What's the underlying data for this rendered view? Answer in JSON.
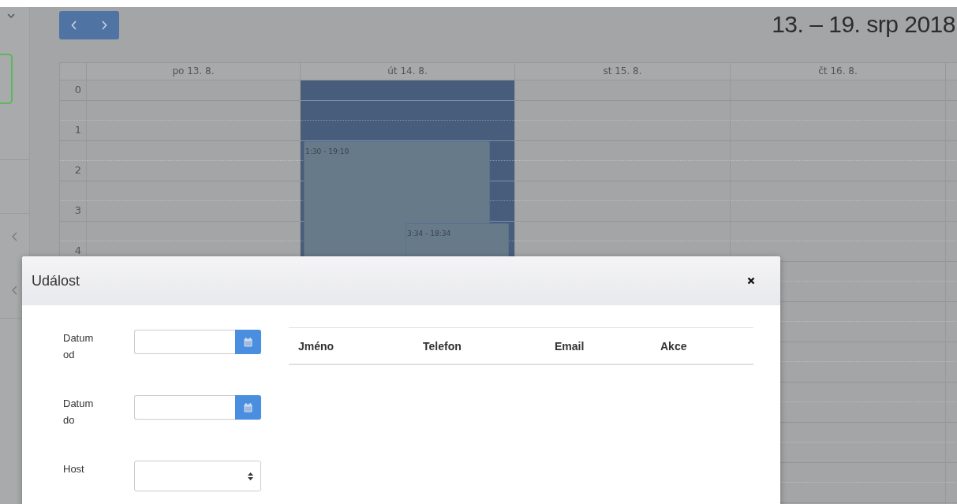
{
  "calendar": {
    "title": "13. – 19. srp 2018",
    "days": [
      {
        "label": "po 13. 8.",
        "selected": false
      },
      {
        "label": "út 14. 8.",
        "selected": true
      },
      {
        "label": "st 15. 8.",
        "selected": false
      },
      {
        "label": "čt 16. 8.",
        "selected": false
      }
    ],
    "hours": [
      "0",
      "1",
      "2",
      "3",
      "4"
    ],
    "events": [
      {
        "label": "1:30 - 19:10"
      },
      {
        "label": "3:34 - 18:34"
      }
    ]
  },
  "dialog": {
    "title": "Událost",
    "fields": [
      {
        "label": "Datum od",
        "kind": "date"
      },
      {
        "label": "Datum do",
        "kind": "date"
      },
      {
        "label": "Host",
        "kind": "select"
      }
    ],
    "table": {
      "columns": [
        "Jméno",
        "Telefon",
        "Email",
        "Akce"
      ]
    }
  }
}
